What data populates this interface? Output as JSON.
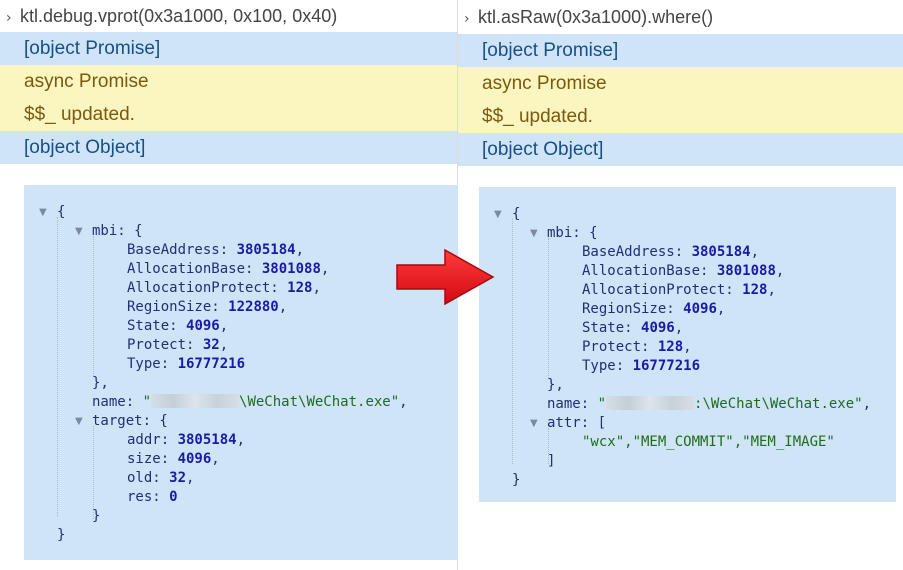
{
  "left": {
    "command": "ktl.debug.vprot(0x3a1000, 0x100, 0x40)",
    "lines": [
      "[object Promise]",
      "async Promise",
      "$$_ updated.",
      "[object Object]"
    ],
    "mbi": {
      "label": "mbi",
      "BaseAddress": "3805184",
      "AllocationBase": "3801088",
      "AllocationProtect": "128",
      "RegionSize": "122880",
      "State": "4096",
      "Protect": "32",
      "Type": "16777216"
    },
    "name_value": "\\WeChat\\WeChat.exe",
    "target": {
      "label": "target",
      "addr": "3805184",
      "size": "4096",
      "old": "32",
      "res": "0"
    }
  },
  "right": {
    "command": "ktl.asRaw(0x3a1000).where()",
    "lines": [
      "[object Promise]",
      "async Promise",
      "$$_ updated.",
      "[object Object]"
    ],
    "mbi": {
      "label": "mbi",
      "BaseAddress": "3805184",
      "AllocationBase": "3801088",
      "AllocationProtect": "128",
      "RegionSize": "4096",
      "State": "4096",
      "Protect": "128",
      "Type": "16777216"
    },
    "name_value": ":\\WeChat\\WeChat.exe",
    "attr": {
      "label": "attr",
      "values": "\"wcx\",\"MEM_COMMIT\",\"MEM_IMAGE\""
    }
  },
  "keys": {
    "BaseAddress": "BaseAddress",
    "AllocationBase": "AllocationBase",
    "AllocationProtect": "AllocationProtect",
    "RegionSize": "RegionSize",
    "State": "State",
    "Protect": "Protect",
    "Type": "Type",
    "name": "name",
    "addr": "addr",
    "size": "size",
    "old": "old",
    "res": "res"
  },
  "icons": {
    "caret": "chevron-right-icon",
    "expand": "triangle-down-icon",
    "arrow": "red-right-arrow-icon"
  },
  "colors": {
    "blue_row": "#cfe5f7",
    "yellow_row": "#fbf5bf",
    "arrow_red": "#e5121b"
  }
}
